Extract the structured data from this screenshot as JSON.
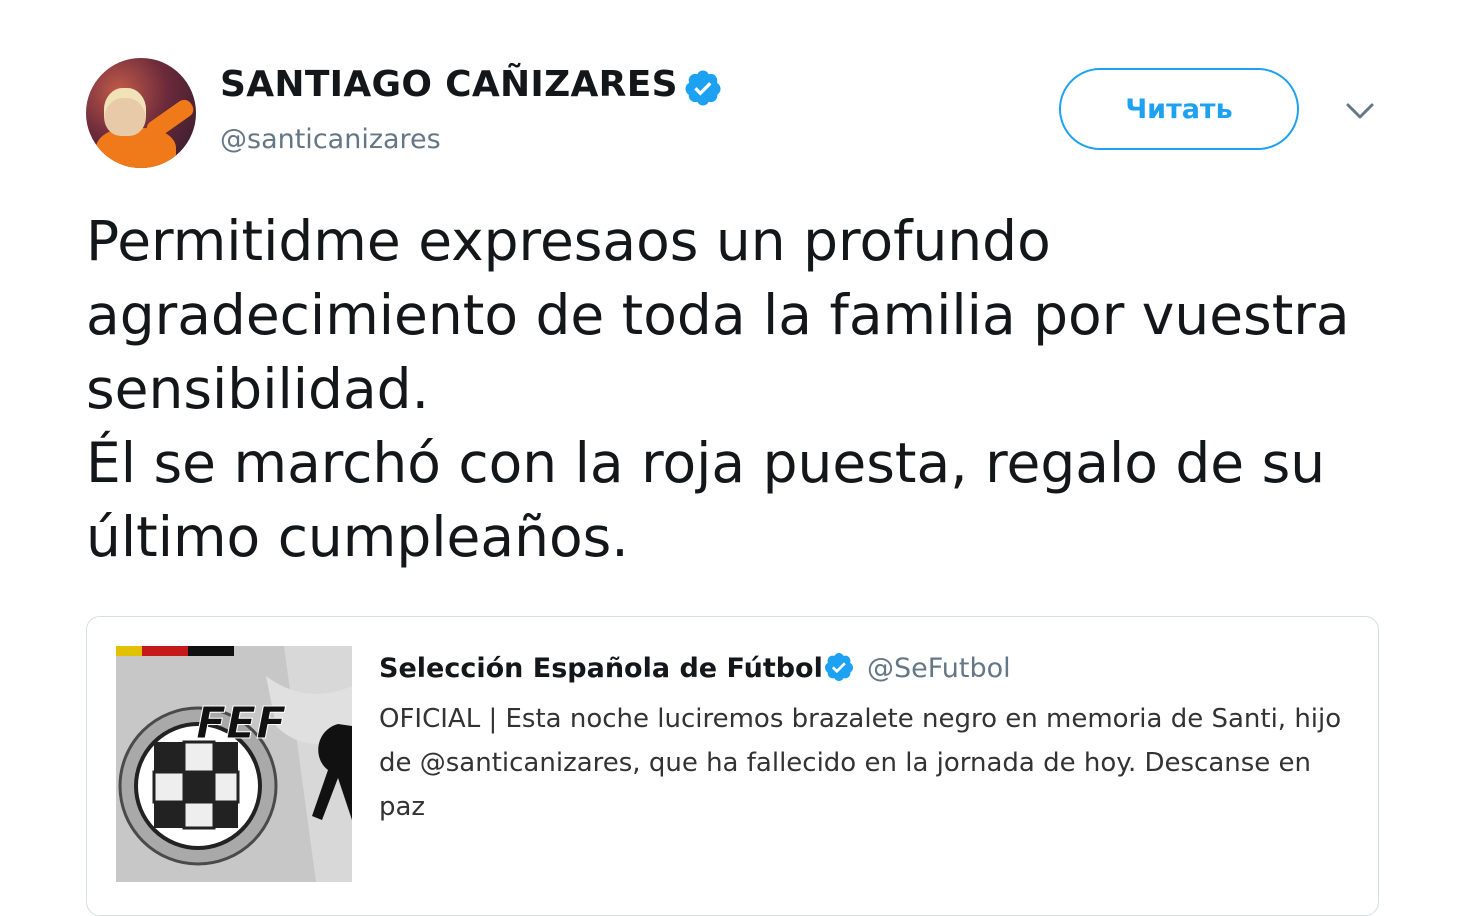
{
  "author": {
    "display_name": "SANTIAGO CAÑIZARES",
    "handle": "@santicanizares",
    "verified": true,
    "avatar_icon": "user-avatar"
  },
  "actions": {
    "follow_label": "Читать",
    "more_icon": "chevron-down-icon"
  },
  "tweet": {
    "paragraphs": [
      "Permitidme expresaos un profundo agradecimiento de toda la familia por vuestra sensibilidad.",
      "Él se marchó con la roja puesta, regalo de su último cumpleaños."
    ]
  },
  "quoted_tweet": {
    "display_name": "Selección Española de Fútbol",
    "handle": "@SeFutbol",
    "verified": true,
    "text": "OFICIAL | Esta noche luciremos brazalete negro en memoria de Santi, hijo de @santicanizares, que ha fallecido en la jornada de hoy. Descanse en paz",
    "image_logo_text": "FEF"
  },
  "colors": {
    "accent": "#1da1f2",
    "text_primary": "#14171a",
    "text_secondary": "#657786",
    "border": "#d6dee4"
  }
}
